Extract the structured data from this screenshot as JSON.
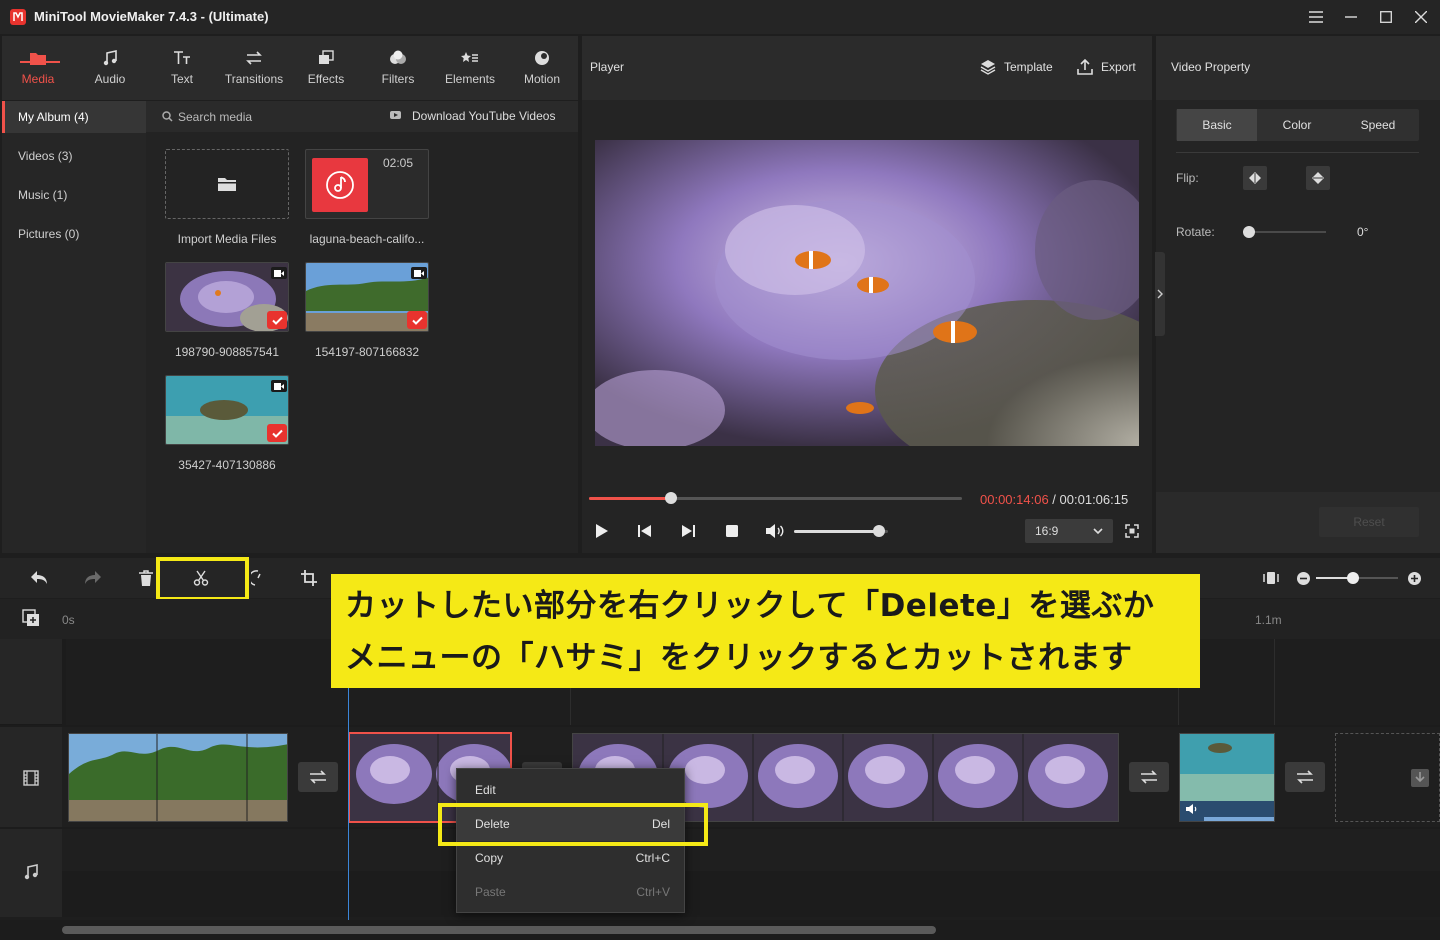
{
  "window": {
    "title": "MiniTool MovieMaker 7.4.3 - (Ultimate)"
  },
  "toolbar": {
    "items": [
      "Media",
      "Audio",
      "Text",
      "Transitions",
      "Effects",
      "Filters",
      "Elements",
      "Motion"
    ]
  },
  "albums": [
    "My Album (4)",
    "Videos (3)",
    "Music (1)",
    "Pictures (0)"
  ],
  "media": {
    "search_placeholder": "Search media",
    "download_label": "Download YouTube Videos",
    "import_label": "Import Media Files",
    "music_duration": "02:05",
    "music_name": "laguna-beach-califo...",
    "clips": [
      "198790-908857541",
      "154197-807166832",
      "35427-407130886"
    ]
  },
  "player": {
    "title": "Player",
    "template_label": "Template",
    "export_label": "Export",
    "current_time": "00:00:14:06",
    "separator": " / ",
    "total_time": "00:01:06:15",
    "progress": 0.22,
    "volume": 0.9,
    "aspect": "16:9"
  },
  "property": {
    "title": "Video Property",
    "tabs": [
      "Basic",
      "Color",
      "Speed"
    ],
    "flip_label": "Flip:",
    "rotate_label": "Rotate:",
    "rotate_value": "0°",
    "reset_label": "Reset"
  },
  "timeline": {
    "ruler_start": "0s",
    "ruler_end": "1.1m",
    "zoom": 0.45
  },
  "context_menu": [
    {
      "label": "Edit",
      "shortcut": ""
    },
    {
      "label": "Delete",
      "shortcut": "Del"
    },
    {
      "label": "Copy",
      "shortcut": "Ctrl+C"
    },
    {
      "label": "Paste",
      "shortcut": "Ctrl+V"
    }
  ],
  "annotation": {
    "line1": "カットしたい部分を右クリックして「Delete」を選ぶか",
    "line2": "メニューの「ハサミ」をクリックするとカットされます"
  },
  "colors": {
    "accent": "#f0524a",
    "highlight": "#f5e916",
    "panel": "#242424"
  }
}
